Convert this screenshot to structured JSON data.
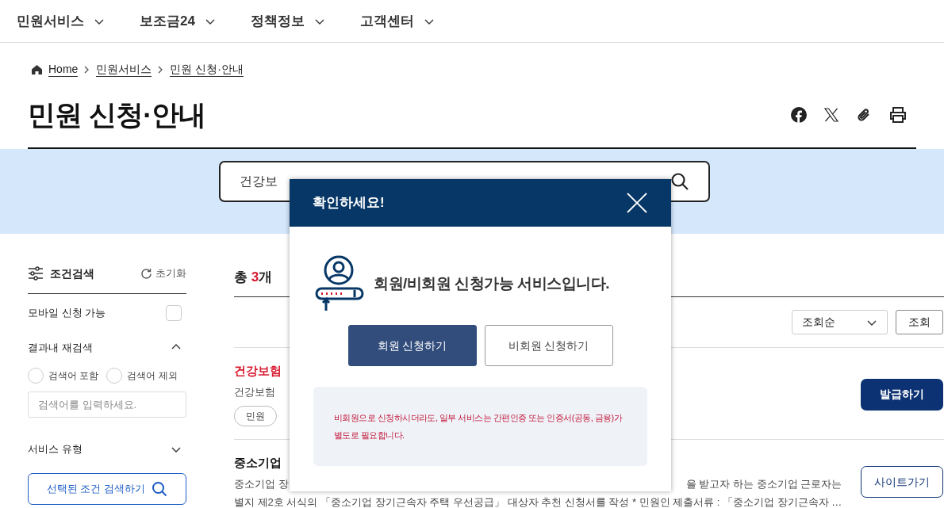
{
  "nav": [
    {
      "label": "민원서비스"
    },
    {
      "label": "보조금24"
    },
    {
      "label": "정책정보"
    },
    {
      "label": "고객센터"
    }
  ],
  "breadcrumb": [
    "Home",
    "민원서비스",
    "민원 신청·안내"
  ],
  "page_title": "민원 신청·안내",
  "search": {
    "value": "건강보"
  },
  "sidebar": {
    "title": "조건검색",
    "reset": "초기화",
    "mobile": {
      "label": "모바일 신청 가능",
      "checked": false
    },
    "refine": {
      "label": "결과내 재검색",
      "expanded": true,
      "options": [
        {
          "label": "검색어 포함",
          "selected": false
        },
        {
          "label": "검색어 제외",
          "selected": false
        }
      ],
      "placeholder": "검색어를 입력하세요."
    },
    "service_type": {
      "label": "서비스 유형",
      "expanded": false
    },
    "submit": "선택된 조건 검색하기"
  },
  "results": {
    "total_prefix": "총 ",
    "total_count": "3",
    "total_suffix": "개",
    "sort": "조회순",
    "sort_button": "조회",
    "items": [
      {
        "title": "건강보험",
        "highlighted": true,
        "desc_left": "건강보험",
        "tags": [
          "민원"
        ],
        "action": {
          "label": "발급하기",
          "kind": "primary"
        }
      },
      {
        "title": "중소기업",
        "highlighted": false,
        "desc_left": "중소기업 장",
        "desc_right": "을 받고자 하는 중소기업 근로자는",
        "desc_line2": "별지 제2호 서식의 「중소기업 장기근속자 주택 우선공급」 대상자 추천 신청서를 작성 * 민원인 제출서류 : 「중소기업 장기근속자 …",
        "action": {
          "label": "사이트가기",
          "kind": "outline"
        }
      }
    ]
  },
  "modal": {
    "title": "확인하세요!",
    "message": "회원/비회원 신청가능 서비스입니다.",
    "buttons": [
      {
        "label": "회원 신청하기",
        "kind": "primary"
      },
      {
        "label": "비회원 신청하기",
        "kind": "outline"
      }
    ],
    "notice": "비회원으로 신청하시더라도, 일부 서비스는 간편인증 또는 인증서(공동, 금융)가 별도로 필요합니다."
  }
}
